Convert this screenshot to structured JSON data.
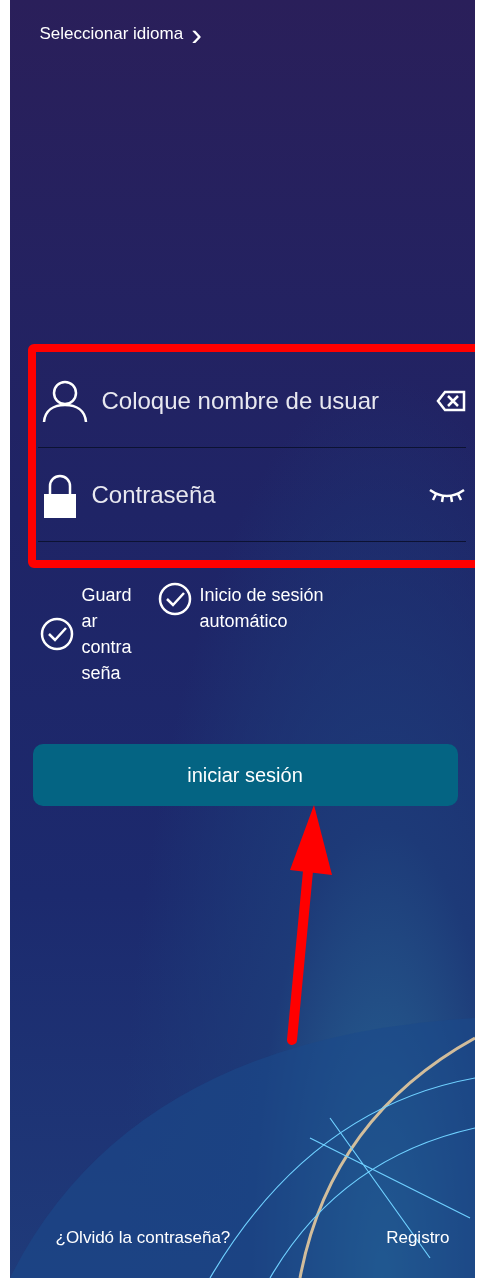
{
  "language_link": {
    "label": "Seleccionar idioma",
    "chevron": "›"
  },
  "fields": [
    {
      "kind": "username",
      "placeholder": "Coloque nombre de usuar"
    },
    {
      "kind": "password",
      "placeholder": "Contraseña"
    }
  ],
  "options": [
    {
      "label": "Guard ar contra seña",
      "checked": true
    },
    {
      "label": "Inicio de sesión automático",
      "checked": true
    }
  ],
  "login_button": {
    "label": "iniciar sesión"
  },
  "footer": {
    "forgot": "¿Olvidó la contraseña?",
    "register": "Registro"
  }
}
